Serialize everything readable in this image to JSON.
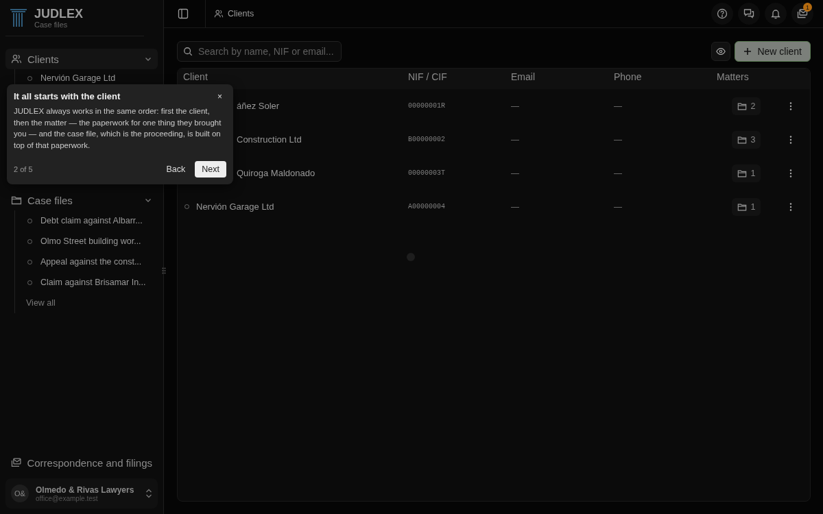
{
  "brand": {
    "name": "JUDLEX",
    "subtitle": "Case files"
  },
  "sidebar": {
    "groups": [
      {
        "label": "Clients",
        "expanded": true,
        "items": [
          "Nervión Garage Ltd"
        ]
      },
      {
        "label": "Case files",
        "expanded": true,
        "items": [
          "Debt claim against Albarr...",
          "Olmo Street building wor...",
          "Appeal against the const...",
          "Claim against Brisamar In..."
        ],
        "footer": "View all"
      }
    ],
    "correspondence": "Correspondence and filings",
    "account": {
      "initials": "O&",
      "name": "Olmedo & Rivas Lawyers",
      "email": "office@example.test"
    }
  },
  "breadcrumb": "Clients",
  "inbox_badge": "1",
  "search": {
    "placeholder": "Search by name, NIF or email..."
  },
  "new_client_button": "New client",
  "table": {
    "columns": [
      "Client",
      "NIF / CIF",
      "Email",
      "Phone",
      "Matters"
    ],
    "rows": [
      {
        "kind": "cut",
        "client": "áñez Soler",
        "nif": "00000001R",
        "email": "—",
        "phone": "—",
        "matters": "2"
      },
      {
        "kind": "cut",
        "client": "Construction Ltd",
        "nif": "B00000002",
        "email": "—",
        "phone": "—",
        "matters": "3"
      },
      {
        "kind": "cut",
        "client": "Quiroga Maldonado",
        "nif": "00000003T",
        "email": "—",
        "phone": "—",
        "matters": "1"
      },
      {
        "kind": "full",
        "client": "Nervión Garage Ltd",
        "nif": "A00000004",
        "email": "—",
        "phone": "—",
        "matters": "1"
      }
    ]
  },
  "tour": {
    "title": "It all starts with the client",
    "body": "JUDLEX always works in the same order: first the client, then the matter — the paperwork for one thing they brought you — and the case file, which is the proceeding, is built on top of that paperwork.",
    "close": "×",
    "step": "2 of 5",
    "back": "Back",
    "next": "Next"
  }
}
